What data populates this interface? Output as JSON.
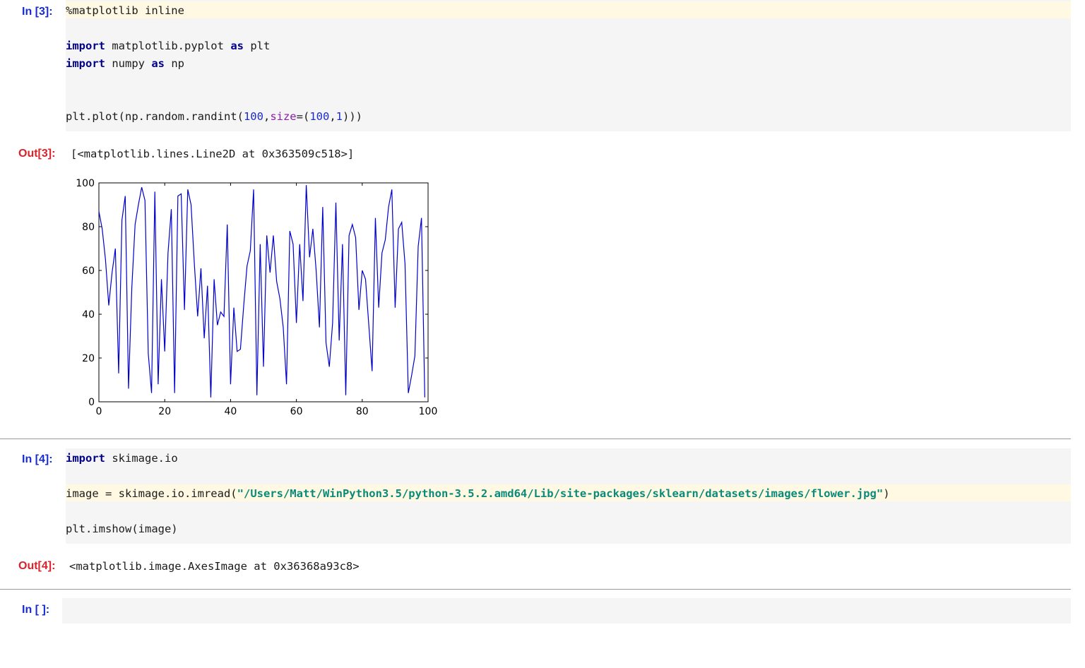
{
  "cells": {
    "cell3": {
      "in_prompt": "In [3]:",
      "out_prompt": "Out[3]:",
      "lines": {
        "l1": "%matplotlib inline",
        "l3_kw1": "import",
        "l3_mid": " matplotlib.pyplot ",
        "l3_kw2": "as",
        "l3_end": " plt",
        "l4_kw1": "import",
        "l4_mid": " numpy ",
        "l4_kw2": "as",
        "l4_end": " np",
        "l7_a": "plt.plot(np.random.randint(",
        "l7_n1": "100",
        "l7_comma": ",",
        "l7_kw": "size",
        "l7_eq": "=(",
        "l7_n2": "100",
        "l7_comma2": ",",
        "l7_n3": "1",
        "l7_end": ")))"
      },
      "output_text": "[<matplotlib.lines.Line2D at 0x363509c518>]"
    },
    "cell4": {
      "in_prompt": "In [4]:",
      "out_prompt": "Out[4]:",
      "lines": {
        "l1_kw": "import",
        "l1_end": " skimage.io",
        "l3_a": "image = skimage.io.imread(",
        "l3_q1": "\"",
        "l3_str": "/Users/Matt/WinPython3.5/python-3.5.2.amd64/Lib/site-packages/sklearn/datasets/images/flower.jpg",
        "l3_q2": "\"",
        "l3_end": ")",
        "l5": "plt.imshow(image)"
      },
      "output_text": "<matplotlib.image.AxesImage at 0x36368a93c8>"
    },
    "cell5": {
      "in_prompt": "In [ ]:"
    }
  },
  "colors": {
    "line": "#0000cc",
    "in_prompt": "#1a2bd0",
    "out_prompt": "#d8232a"
  },
  "chart_data": {
    "type": "line",
    "title": "",
    "xlabel": "",
    "ylabel": "",
    "xlim": [
      0,
      100
    ],
    "ylim": [
      0,
      100
    ],
    "xticks": [
      "0",
      "20",
      "40",
      "60",
      "80",
      "100"
    ],
    "yticks": [
      "0",
      "20",
      "40",
      "60",
      "80",
      "100"
    ],
    "grid": false,
    "series": [
      {
        "color": "#0000cc",
        "x": [
          0,
          1,
          2,
          3,
          4,
          5,
          6,
          7,
          8,
          9,
          10,
          11,
          12,
          13,
          14,
          15,
          16,
          17,
          18,
          19,
          20,
          21,
          22,
          23,
          24,
          25,
          26,
          27,
          28,
          29,
          30,
          31,
          32,
          33,
          34,
          35,
          36,
          37,
          38,
          39,
          40,
          41,
          42,
          43,
          44,
          45,
          46,
          47,
          48,
          49,
          50,
          51,
          52,
          53,
          54,
          55,
          56,
          57,
          58,
          59,
          60,
          61,
          62,
          63,
          64,
          65,
          66,
          67,
          68,
          69,
          70,
          71,
          72,
          73,
          74,
          75,
          76,
          77,
          78,
          79,
          80,
          81,
          82,
          83,
          84,
          85,
          86,
          87,
          88,
          89,
          90,
          91,
          92,
          93,
          94,
          95,
          96,
          97,
          98,
          99
        ],
        "y": [
          87,
          79,
          65,
          44,
          59,
          70,
          13,
          83,
          94,
          6,
          52,
          81,
          90,
          98,
          92,
          22,
          4,
          96,
          8,
          56,
          23,
          68,
          88,
          4,
          94,
          95,
          42,
          97,
          90,
          63,
          39,
          61,
          29,
          53,
          2,
          56,
          35,
          41,
          39,
          81,
          8,
          43,
          23,
          24,
          44,
          62,
          69,
          97,
          3,
          72,
          16,
          76,
          59,
          76,
          55,
          47,
          34,
          8,
          78,
          72,
          36,
          72,
          46,
          99,
          66,
          79,
          60,
          34,
          89,
          27,
          16,
          36,
          91,
          28,
          72,
          3,
          76,
          81,
          75,
          42,
          60,
          56,
          35,
          14,
          84,
          43,
          68,
          74,
          89,
          97,
          43,
          79,
          82,
          63,
          4,
          12,
          21,
          71,
          84,
          2
        ]
      }
    ]
  }
}
